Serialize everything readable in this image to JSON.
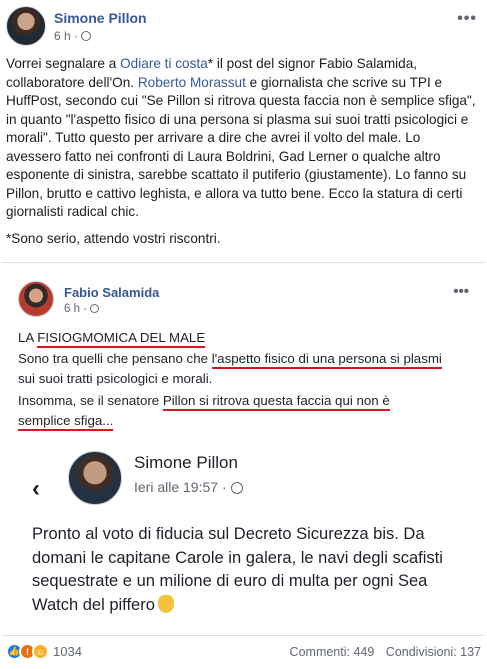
{
  "post": {
    "author": "Simone Pillon",
    "time": "6 h",
    "paragraph1_parts": [
      "Vorrei segnalare a ",
      "Odiare ti costa",
      "* il post del signor Fabio Salamida, collaboratore dell'On. ",
      "Roberto Morassut",
      " e giornalista che scrive su TPI e HuffPost, secondo cui \"Se Pillon si ritrova questa faccia non è semplice sfiga\", in quanto \"l'aspetto fisico di una persona si plasma sui suoi tratti psicologici e morali\". Tutto questo per arrivare a dire che avrei il volto del male. Lo avessero fatto nei confronti di Laura Boldrini, Gad Lerner o qualche altro esponente di sinistra, sarebbe scattato il putiferio (giustamente). Lo fanno su Pillon, brutto e cattivo leghista, e allora va tutto bene. Ecco la statura di certi giornalisti radical chic."
    ],
    "paragraph2": "*Sono serio, attendo vostri riscontri."
  },
  "shared_image": {
    "inner_author": "Fabio Salamida",
    "inner_time": "6 h",
    "line1_a": "LA ",
    "line1_b": "FISIOGMOMICA DEL MALE",
    "line2_a": "Sono tra quelli che pensano che ",
    "line2_b": "l'aspetto fisico di una persona si plasmi",
    "line3": "sui suoi tratti psicologici e morali.",
    "line4_a": "Insomma, se il senatore ",
    "line4_b": "Pillon si ritrova questa faccia qui non è",
    "line5": "semplice sfiga...",
    "nested": {
      "author": "Simone Pillon",
      "time": "Ieri alle 19:57",
      "text": "Pronto al voto di fiducia sul Decreto Sicurezza bis. Da domani le capitane Carole in galera, le navi degli scafisti sequestrate e un milione di euro di multa per ogni Sea Watch del piffero"
    }
  },
  "footer": {
    "reactions_count": "1034",
    "comments": "Commenti: 449",
    "shares": "Condivisioni: 137"
  },
  "icons": {
    "more": "more-options-icon",
    "globe": "globe-icon",
    "back": "back-arrow-icon"
  },
  "colors": {
    "link": "#385898",
    "underline": "#d6171b"
  }
}
